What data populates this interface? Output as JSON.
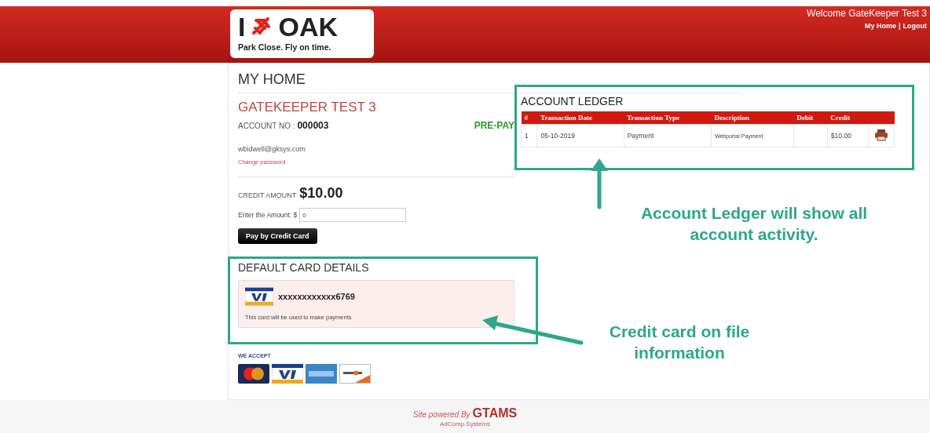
{
  "header": {
    "logo": {
      "prefix": "I",
      "name": "OAK",
      "tagline": "Park Close. Fly on time."
    },
    "welcome": "Welcome GateKeeper Test 3",
    "links": [
      "My Home",
      "Logout"
    ],
    "separator": "|"
  },
  "page_title": "MY HOME",
  "account": {
    "name": "GATEKEEPER TEST 3",
    "number_label": "ACCOUNT NO :",
    "number": "000003",
    "plan": "PRE-PAY",
    "email": "wbidwell@gksys.com",
    "change_password": "Change password"
  },
  "credit": {
    "label": "CREDIT AMOUNT",
    "value": "$10.00"
  },
  "amount_field": {
    "label": "Enter the Amount: $",
    "value": "0"
  },
  "pay_button": "Pay by Credit Card",
  "default_card": {
    "title": "DEFAULT CARD DETAILS",
    "number": "xxxxxxxxxxxx6769",
    "note": "This card will be used to make payments"
  },
  "we_accept": {
    "label": "WE ACCEPT",
    "cards": [
      {
        "kind": "mastercard"
      },
      {
        "kind": "visa"
      },
      {
        "kind": "amex"
      },
      {
        "kind": "discover"
      }
    ]
  },
  "ledger": {
    "title": "ACCOUNT LEDGER",
    "columns": [
      "#",
      "Transaction Date",
      "Transaction Type",
      "Description",
      "Debit",
      "Credit"
    ],
    "rows": [
      {
        "cells": [
          "1",
          "05-10-2019",
          "Payment",
          "Webportal Payment",
          "",
          "$10.00"
        ]
      }
    ]
  },
  "annotations": [
    {
      "kind": "up",
      "text": "Account Ledger will show all account activity."
    },
    {
      "kind": "left",
      "text": "Credit card on file information"
    }
  ],
  "footer": {
    "powered": "Site powered By",
    "brand": "GTAMS",
    "company": "AdComp Systems"
  }
}
